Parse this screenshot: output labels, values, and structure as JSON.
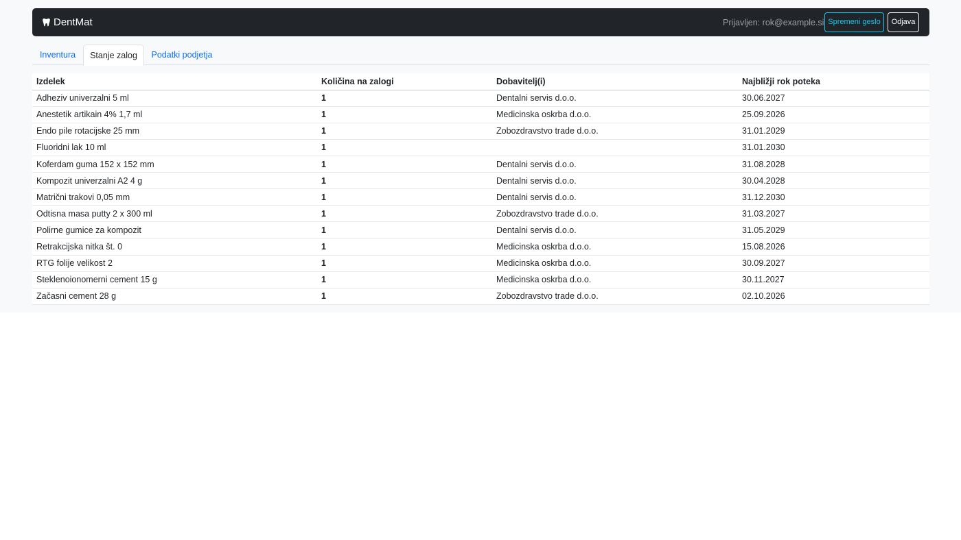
{
  "navbar": {
    "brand": "DentMat",
    "brand_icon": "tooth-icon",
    "user_label": "Prijavljen: rok@example.si",
    "change_password_label": "Spremeni geslo",
    "logout_label": "Odjava"
  },
  "tabs": [
    {
      "label": "Inventura",
      "active": false
    },
    {
      "label": "Stanje zalog",
      "active": true
    },
    {
      "label": "Podatki podjetja",
      "active": false
    }
  ],
  "table": {
    "columns": [
      "Izdelek",
      "Količina na zalogi",
      "Dobavitelj(i)",
      "Najbližji rok poteka"
    ],
    "rows": [
      [
        "Adheziv univerzalni 5 ml",
        "1",
        "Dentalni servis d.o.o.",
        "30.06.2027"
      ],
      [
        "Anestetik artikain 4% 1,7 ml",
        "1",
        "Medicinska oskrba d.o.o.",
        "25.09.2026"
      ],
      [
        "Endo pile rotacijske 25 mm",
        "1",
        "Zobozdravstvo trade d.o.o.",
        "31.01.2029"
      ],
      [
        "Fluoridni lak 10 ml",
        "1",
        "",
        "31.01.2030"
      ],
      [
        "Koferdam guma 152 x 152 mm",
        "1",
        "Dentalni servis d.o.o.",
        "31.08.2028"
      ],
      [
        "Kompozit univerzalni A2 4 g",
        "1",
        "Dentalni servis d.o.o.",
        "30.04.2028"
      ],
      [
        "Matrični trakovi 0,05 mm",
        "1",
        "Dentalni servis d.o.o.",
        "31.12.2030"
      ],
      [
        "Odtisna masa putty 2 x 300 ml",
        "1",
        "Zobozdravstvo trade d.o.o.",
        "31.03.2027"
      ],
      [
        "Polirne gumice za kompozit",
        "1",
        "Dentalni servis d.o.o.",
        "31.05.2029"
      ],
      [
        "Retrakcijska nitka št. 0",
        "1",
        "Medicinska oskrba d.o.o.",
        "15.08.2026"
      ],
      [
        "RTG folije velikost 2",
        "1",
        "Medicinska oskrba d.o.o.",
        "30.09.2027"
      ],
      [
        "Steklenoionomerni cement 15 g",
        "1",
        "Medicinska oskrba d.o.o.",
        "30.11.2027"
      ],
      [
        "Začasni cement 28 g",
        "1",
        "Zobozdravstvo trade d.o.o.",
        "02.10.2026"
      ]
    ]
  },
  "colors": {
    "navbar_bg": "#212529",
    "link": "#0d6efd",
    "info_outline": "#0dcaf0",
    "page_bg": "#f8f9fa"
  }
}
